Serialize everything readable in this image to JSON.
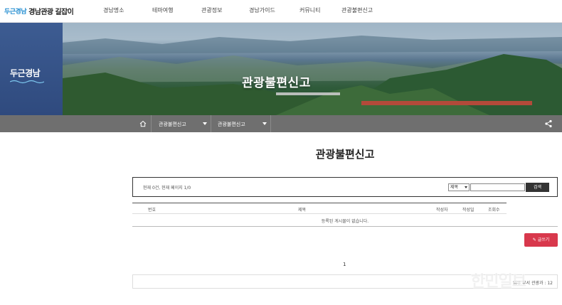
{
  "header": {
    "logo_mark": "두근경남",
    "logo_text": "경남관광 길잡이",
    "nav": [
      "경남명소",
      "테마여행",
      "관광정보",
      "경남가이드",
      "커뮤니티",
      "관광불편신고"
    ]
  },
  "hero": {
    "side_logo": "두근경남",
    "title": "관광불편신고"
  },
  "subnav": {
    "home_icon": "home-icon",
    "menu1": "관광불편신고",
    "menu2": "관광불편신고",
    "share_icon": "share-icon"
  },
  "page": {
    "title": "관광불편신고"
  },
  "search": {
    "info": "현재 0건, 현재 페이지 1/0",
    "select_value": "제목",
    "input_value": "",
    "button": "검색"
  },
  "table": {
    "headers": [
      "번호",
      "제목",
      "작성자",
      "작성일",
      "조회수"
    ],
    "empty_message": "등록된 게시물이 없습니다."
  },
  "actions": {
    "write": "글쓰기"
  },
  "pagination": {
    "current": "1"
  },
  "footer": {
    "text": "업무 부서 관광과 : 12"
  },
  "watermark": "한민일보",
  "colors": {
    "subnav_bg": "#6f6f6f",
    "write_button": "#d8384c",
    "hero_side": "#3d5c92"
  }
}
